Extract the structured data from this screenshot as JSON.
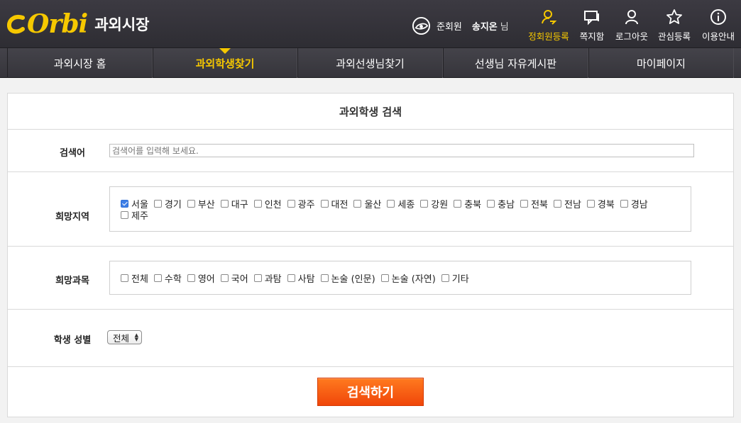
{
  "header": {
    "logo_text": "Orbi",
    "section_name": "과외시장",
    "user": {
      "grade": "준회원",
      "name": "송지온",
      "suffix": "님"
    },
    "nav": [
      {
        "label": "정회원등록",
        "icon": "user-star-icon",
        "active": true
      },
      {
        "label": "쪽지함",
        "icon": "message-icon",
        "active": false
      },
      {
        "label": "로그아웃",
        "icon": "user-icon",
        "active": false
      },
      {
        "label": "관심등록",
        "icon": "star-icon",
        "active": false
      },
      {
        "label": "이용안내",
        "icon": "info-icon",
        "active": false
      }
    ]
  },
  "main_nav": {
    "tabs": [
      {
        "label": "과외시장 홈",
        "active": false
      },
      {
        "label": "과외학생찾기",
        "active": true
      },
      {
        "label": "과외선생님찾기",
        "active": false
      },
      {
        "label": "선생님 자유게시판",
        "active": false
      },
      {
        "label": "마이페이지",
        "active": false
      }
    ]
  },
  "search_form": {
    "title": "과외학생 검색",
    "keyword": {
      "label": "검색어",
      "placeholder": "검색어를 입력해 보세요.",
      "value": ""
    },
    "regions": {
      "label": "희망지역",
      "options": [
        {
          "label": "서울",
          "checked": true
        },
        {
          "label": "경기",
          "checked": false
        },
        {
          "label": "부산",
          "checked": false
        },
        {
          "label": "대구",
          "checked": false
        },
        {
          "label": "인천",
          "checked": false
        },
        {
          "label": "광주",
          "checked": false
        },
        {
          "label": "대전",
          "checked": false
        },
        {
          "label": "울산",
          "checked": false
        },
        {
          "label": "세종",
          "checked": false
        },
        {
          "label": "강원",
          "checked": false
        },
        {
          "label": "충북",
          "checked": false
        },
        {
          "label": "충남",
          "checked": false
        },
        {
          "label": "전북",
          "checked": false
        },
        {
          "label": "전남",
          "checked": false
        },
        {
          "label": "경북",
          "checked": false
        },
        {
          "label": "경남",
          "checked": false
        },
        {
          "label": "제주",
          "checked": false
        }
      ]
    },
    "subjects": {
      "label": "희망과목",
      "options": [
        {
          "label": "전체",
          "checked": false
        },
        {
          "label": "수학",
          "checked": false
        },
        {
          "label": "영어",
          "checked": false
        },
        {
          "label": "국어",
          "checked": false
        },
        {
          "label": "과탐",
          "checked": false
        },
        {
          "label": "사탐",
          "checked": false
        },
        {
          "label": "논술 (인문)",
          "checked": false
        },
        {
          "label": "논술 (자연)",
          "checked": false
        },
        {
          "label": "기타",
          "checked": false
        }
      ]
    },
    "gender": {
      "label": "학생 성별",
      "selected": "전체"
    },
    "submit_label": "검색하기"
  },
  "colors": {
    "accent": "#f6c800",
    "button": "#f25a10",
    "header_bg": "#35343a"
  }
}
